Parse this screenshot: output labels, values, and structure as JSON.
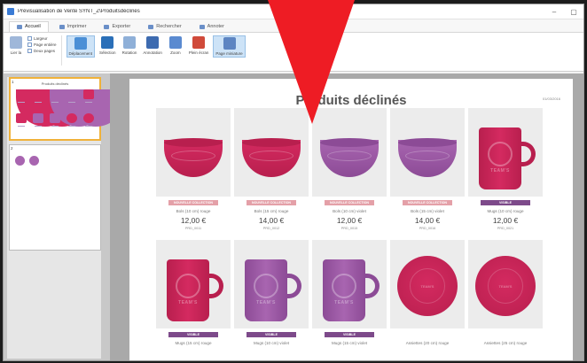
{
  "window": {
    "title": "Prévisualisation de Vente SYNT_Z\\Produitsdéclinés",
    "minimize_glyph": "–",
    "restore_glyph": "▢"
  },
  "tabs": [
    {
      "label": "Accueil",
      "active": true
    },
    {
      "label": "Imprimer",
      "active": false
    },
    {
      "label": "Exporter",
      "active": false
    },
    {
      "label": "Rechercher",
      "active": false
    },
    {
      "label": "Annoter",
      "active": false
    }
  ],
  "ribbon": {
    "small_group": [
      "Largeur",
      "Page entière",
      "Deux pages"
    ],
    "first_button": "Lier la",
    "buttons": [
      "Déplacement",
      "Sélection",
      "Rotation",
      "Annotation",
      "Zoom",
      "Plein écran",
      "Page miniature"
    ],
    "zoom_sublabel": "Zoom avant"
  },
  "thumbnails": {
    "page1_number": "1",
    "page1_title": "Produits déclinés",
    "page2_number": "2"
  },
  "page": {
    "title": "Produits déclinés",
    "page_number": "01/03/2016"
  },
  "colors": {
    "pink": "#d42a60",
    "pink_dark": "#b81f4e",
    "violet": "#a865b0",
    "violet_dark": "#8c4b96",
    "badge_new": "#e4a0a8",
    "badge_label": "#7d4a8a"
  },
  "products_row1": [
    {
      "kind": "bowl",
      "color": "pink",
      "badge": "NOUVELLE COLLECTION",
      "badge_style": "new",
      "name": "Bols (10 cm) rouge",
      "price": "12,00 €",
      "ref": "PRD_0011"
    },
    {
      "kind": "bowl",
      "color": "pink",
      "badge": "NOUVELLE COLLECTION",
      "badge_style": "new",
      "name": "Bols (15 cm) rouge",
      "price": "14,00 €",
      "ref": "PRD_0012"
    },
    {
      "kind": "bowl",
      "color": "violet",
      "badge": "NOUVELLE COLLECTION",
      "badge_style": "new",
      "name": "Bols (10 cm) violet",
      "price": "12,00 €",
      "ref": "PRD_0015"
    },
    {
      "kind": "bowl",
      "color": "violet",
      "badge": "NOUVELLE COLLECTION",
      "badge_style": "new",
      "name": "Bols (15 cm) violet",
      "price": "14,00 €",
      "ref": "PRD_0016"
    },
    {
      "kind": "mug",
      "color": "pink",
      "badge": "VISIBLE",
      "badge_style": "label",
      "name": "Mugs (10 cm) rouge",
      "price": "12,00 €",
      "ref": "PRD_0021"
    }
  ],
  "products_row2": [
    {
      "kind": "mug",
      "color": "pink",
      "badge": "VISIBLE",
      "badge_style": "label",
      "name": "Mugs (15 cm) rouge"
    },
    {
      "kind": "mug",
      "color": "violet",
      "badge": "VISIBLE",
      "badge_style": "label",
      "name": "Mugs (10 cm) violet"
    },
    {
      "kind": "mug",
      "color": "violet",
      "badge": "VISIBLE",
      "badge_style": "label",
      "name": "Mugs (15 cm) violet"
    },
    {
      "kind": "plate",
      "color": "pink",
      "badge": "",
      "badge_style": "none",
      "name": "Assiettes (20 cm) rouge"
    },
    {
      "kind": "plate",
      "color": "pink",
      "badge": "",
      "badge_style": "none",
      "name": "Assiettes (25 cm) rouge"
    }
  ],
  "brand_mark": "TEAM'S"
}
